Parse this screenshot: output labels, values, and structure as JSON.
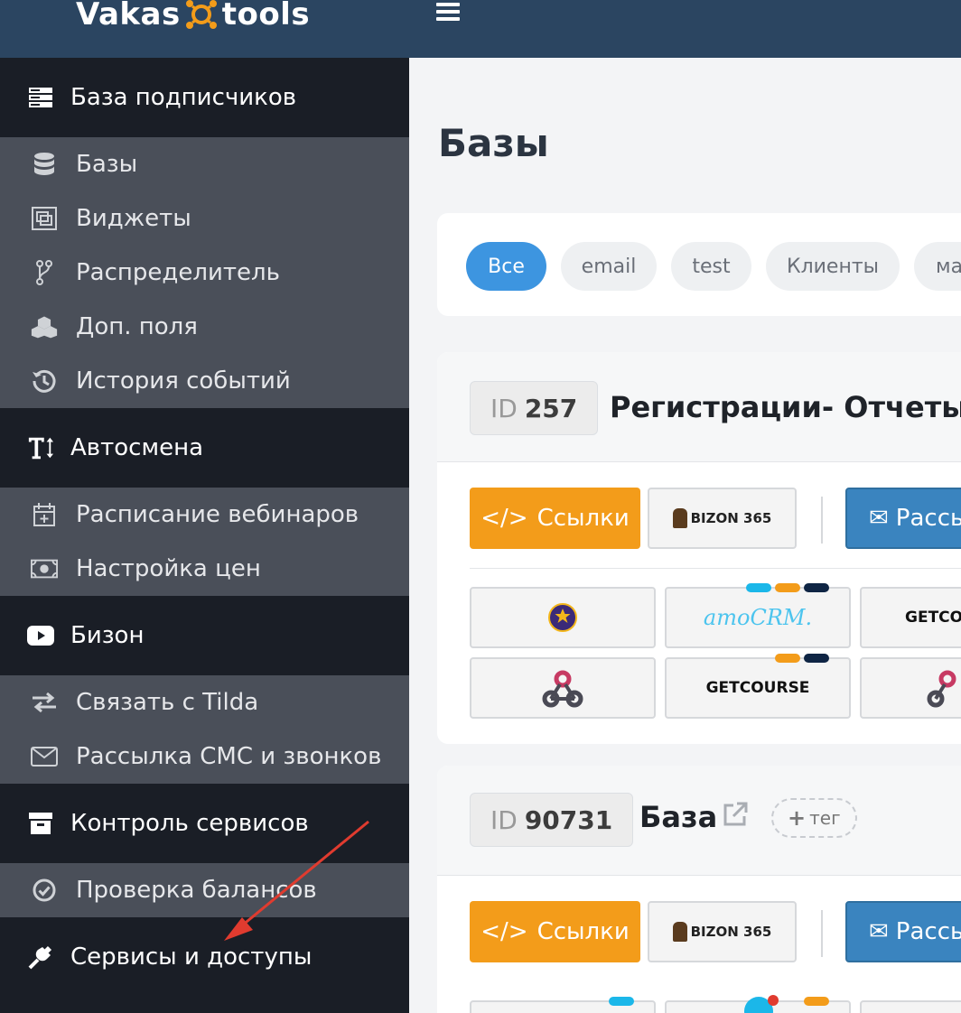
{
  "header": {
    "logo_left": "Vakas",
    "logo_right": "tools"
  },
  "sidebar": {
    "sections": [
      {
        "title": "База подписчиков",
        "items": [
          "Базы",
          "Виджеты",
          "Распределитель",
          "Доп. поля",
          "История событий"
        ]
      },
      {
        "title": "Автосмена",
        "items": [
          "Расписание вебинаров",
          "Настройка цен"
        ]
      },
      {
        "title": "Бизон",
        "items": [
          "Связать с Tilda",
          "Рассылка СМС и звонков"
        ]
      },
      {
        "title": "Контроль сервисов",
        "items": [
          "Проверка балансов"
        ]
      },
      {
        "title": "Сервисы и доступы",
        "items": []
      }
    ]
  },
  "main": {
    "title": "Базы",
    "filters": [
      "Все",
      "email",
      "test",
      "Клиенты",
      "ма"
    ],
    "databases": [
      {
        "id_label": "ID",
        "id": "257",
        "name": "Регистрации- Отчеты"
      },
      {
        "id_label": "ID",
        "id": "90731",
        "name": "База",
        "tag_button": "тег"
      }
    ],
    "buttons": {
      "links": "Ссылки",
      "bizon": "BIZON 365",
      "mail": "Рассы"
    },
    "integrations": {
      "webinar": "WEBINAR STARS",
      "amocrm": "amoCRM.",
      "getcourse": "GETCOURSE",
      "getcourse_cut": "GETCO"
    }
  },
  "colors": {
    "header": "#2b4561",
    "sidebar": "#1a1e26",
    "submenu": "#4a4f59",
    "accent_orange": "#f39c1a",
    "accent_blue": "#3d95e0",
    "arrow": "#e03b2f"
  }
}
